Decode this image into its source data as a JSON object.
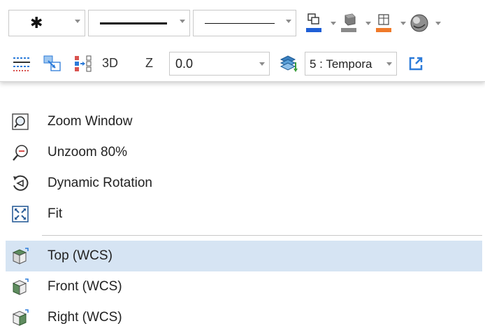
{
  "toolbar": {
    "row1": {
      "marker_symbol": "✱",
      "line_style_1": "solid-thick",
      "line_style_2": "solid-thin"
    },
    "row2": {
      "label_3d": "3D",
      "label_z": "Z",
      "z_value": "0.0",
      "layer_value": "5 : Tempora"
    },
    "colors": {
      "blue": "#1f5fd6",
      "gray": "#8a8a8a",
      "orange": "#f07a2a",
      "accent": "#2c7bd9"
    }
  },
  "menu": {
    "items": [
      {
        "label": "Zoom Window",
        "icon": "zoom-window-icon"
      },
      {
        "label": "Unzoom 80%",
        "icon": "unzoom-icon"
      },
      {
        "label": "Dynamic Rotation",
        "icon": "dynamic-rotation-icon"
      },
      {
        "label": "Fit",
        "icon": "fit-icon"
      },
      {
        "label": "Top (WCS)",
        "icon": "top-view-icon",
        "selected": true
      },
      {
        "label": "Front (WCS)",
        "icon": "front-view-icon"
      },
      {
        "label": "Right (WCS)",
        "icon": "right-view-icon"
      }
    ]
  }
}
